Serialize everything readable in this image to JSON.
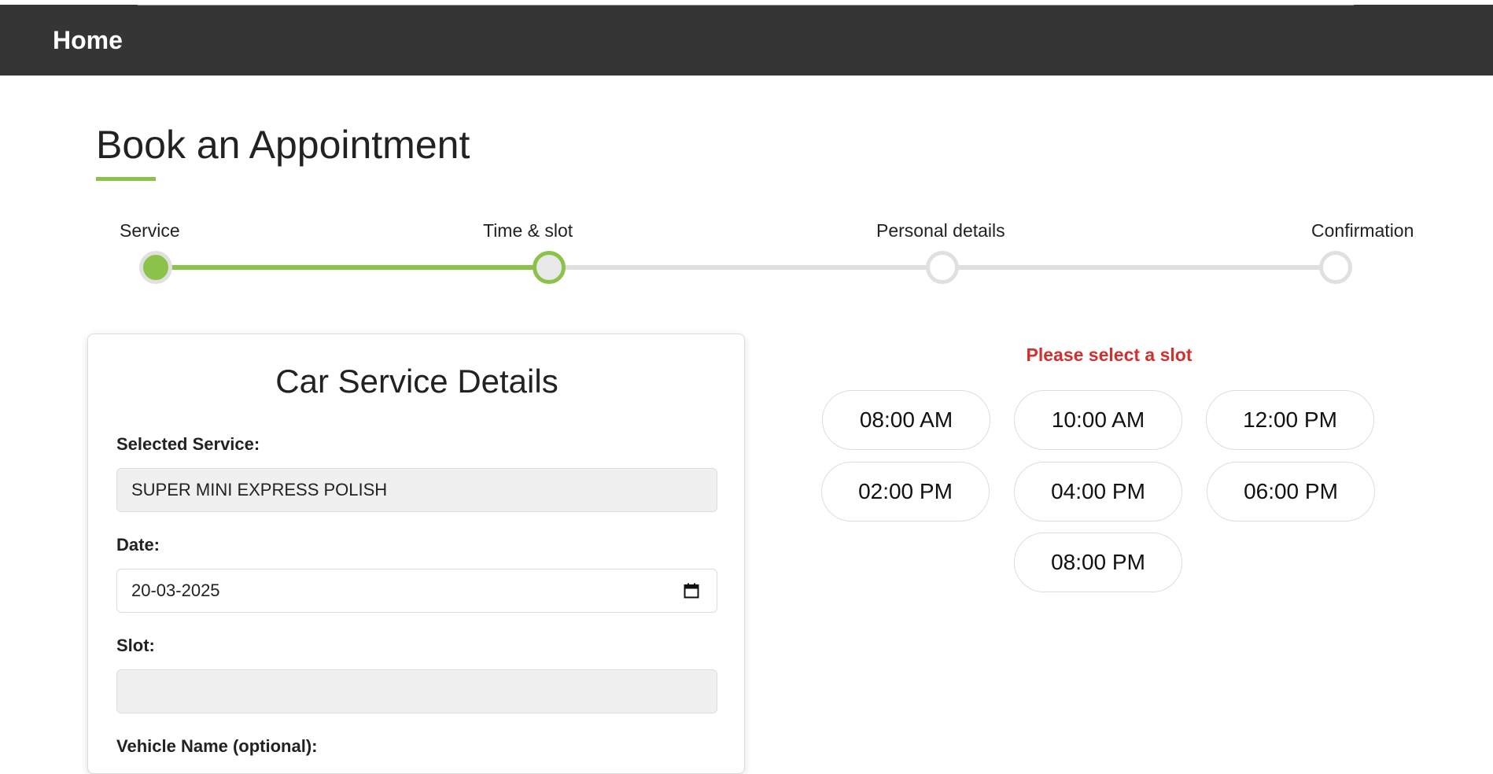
{
  "nav": {
    "home_label": "Home"
  },
  "page": {
    "title": "Book an Appointment"
  },
  "stepper": {
    "steps": [
      {
        "label": "Service",
        "state": "completed"
      },
      {
        "label": "Time & slot",
        "state": "current"
      },
      {
        "label": "Personal details",
        "state": "pending"
      },
      {
        "label": "Confirmation",
        "state": "pending"
      }
    ]
  },
  "card": {
    "title": "Car Service Details",
    "selected_service_label": "Selected Service:",
    "selected_service_value": "SUPER MINI EXPRESS POLISH",
    "date_label": "Date:",
    "date_value": "20-03-2025",
    "slot_label": "Slot:",
    "slot_value": "",
    "vehicle_label": "Vehicle Name (optional):"
  },
  "slots": {
    "error_message": "Please select a slot",
    "times": [
      "08:00 AM",
      "10:00 AM",
      "12:00 PM",
      "02:00 PM",
      "04:00 PM",
      "06:00 PM",
      "08:00 PM"
    ]
  },
  "colors": {
    "navbar_bg": "#353535",
    "accent_green": "#8bc34a",
    "error_red": "#d32f2f",
    "track_gray": "#e0e0e0"
  },
  "icons": {
    "date_picker": "calendar-icon"
  }
}
